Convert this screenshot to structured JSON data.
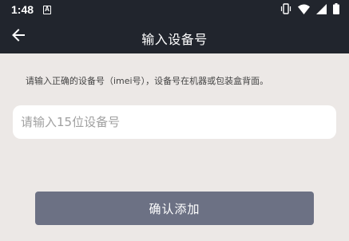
{
  "status_bar": {
    "time": "1:48",
    "notification_letter": "A",
    "icons": [
      "vibrate-icon",
      "wifi-icon",
      "signal-icon",
      "battery-icon"
    ]
  },
  "app_bar": {
    "title": "输入设备号",
    "back_icon": "arrow-left-icon"
  },
  "form": {
    "hint": "请输入正确的设备号（imei号），设备号在机器或包装盒背面。",
    "device_input": {
      "value": "",
      "placeholder": "请输入15位设备号"
    },
    "submit_label": "确认添加"
  },
  "colors": {
    "bar_background": "#21252d",
    "page_background": "#ece8e6",
    "button_background": "#6c7184"
  }
}
